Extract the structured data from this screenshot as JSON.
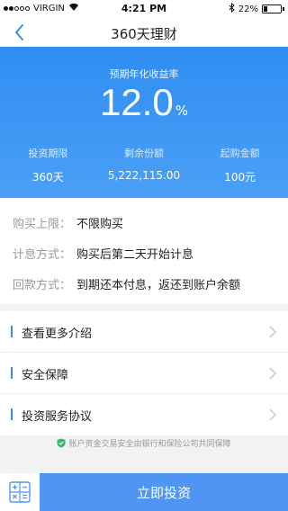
{
  "status_bar": {
    "carrier": "VIRGIN",
    "time": "4:21 PM",
    "battery": "22%",
    "battery_level": 0.22
  },
  "nav": {
    "title": "360天理财"
  },
  "hero": {
    "label": "预期年化收益率",
    "rate_value": "12.0",
    "rate_unit": "%",
    "stats": [
      {
        "label": "投资期限",
        "value": "360天"
      },
      {
        "label": "剩余份额",
        "value": "5,222,115.00"
      },
      {
        "label": "起购金额",
        "value": "100元"
      }
    ]
  },
  "info": [
    {
      "key": "购买上限：",
      "value": "不限购买"
    },
    {
      "key": "计息方式：",
      "value": "购买后第二天开始计息"
    },
    {
      "key": "回款方式：",
      "value": "到期还本付息，返还到账户余额"
    }
  ],
  "links": [
    {
      "label": "查看更多介绍"
    },
    {
      "label": "安全保障"
    },
    {
      "label": "投资服务协议"
    }
  ],
  "safety_note": "账户资金交易安全由银行和保险公司共同保障",
  "bottom": {
    "invest_label": "立即投资"
  },
  "colors": {
    "accent": "#2f8df2",
    "button": "#4f95f4",
    "safety_green": "#3cb371"
  }
}
